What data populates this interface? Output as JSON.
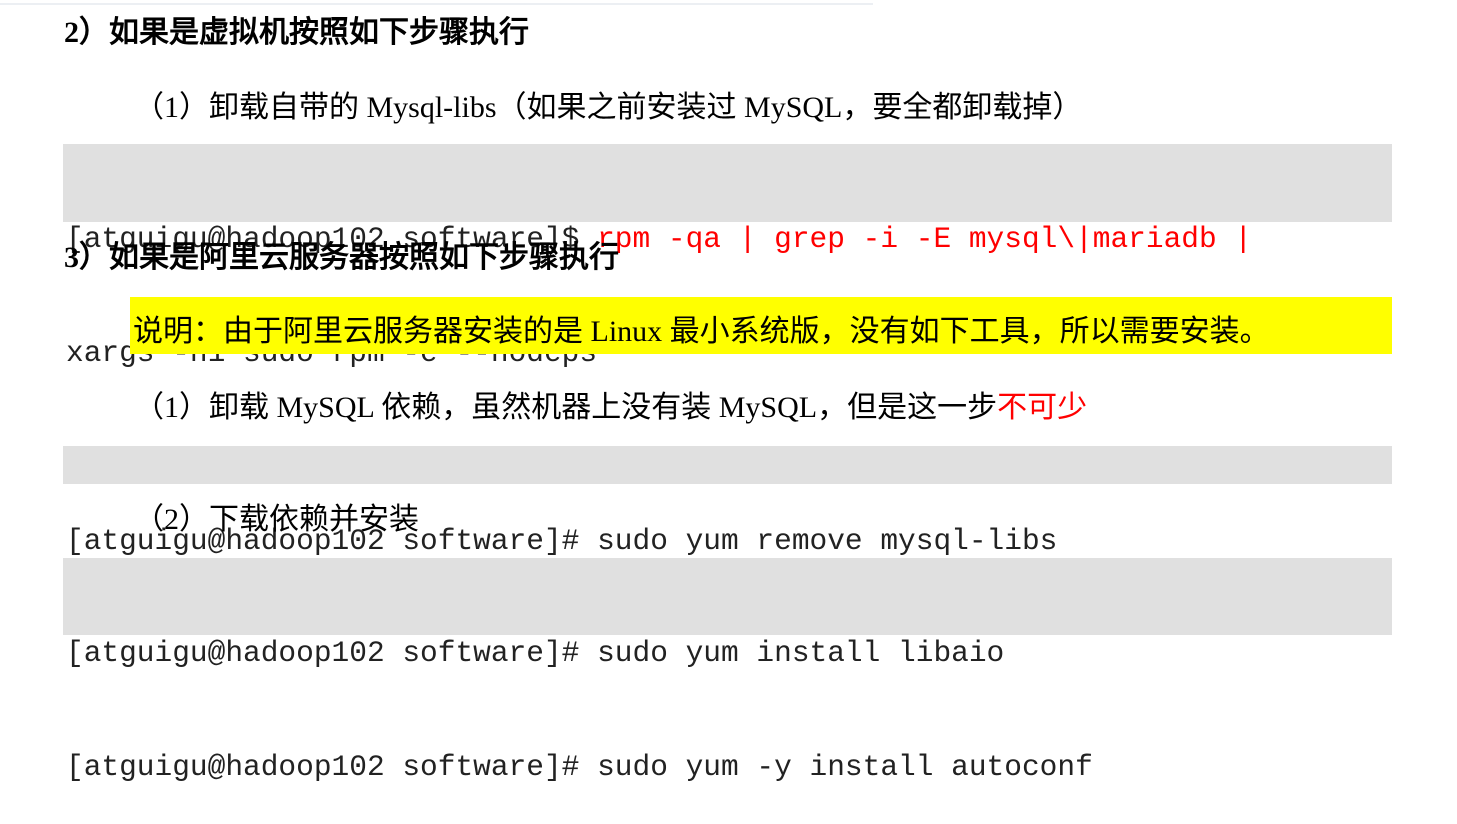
{
  "sections": [
    {
      "heading": "2）如果是虚拟机按照如下步骤执行",
      "step1": {
        "text": "（1）卸载自带的 Mysql-libs（如果之前安装过 MySQL，要全都卸载掉）"
      },
      "code1": {
        "prompt": "[atguigu@hadoop102 software]$ ",
        "command_line1": "rpm -qa | grep -i -E mysql\\|mariadb |",
        "command_line2": "xargs -n1 sudo rpm -e --nodeps"
      }
    },
    {
      "heading": "3）如果是阿里云服务器按照如下步骤执行",
      "note": "说明：由于阿里云服务器安装的是 Linux 最小系统版，没有如下工具，所以需要安装。",
      "step1": {
        "text": "（1）卸载 MySQL 依赖，虽然机器上没有装 MySQL，但是这一步",
        "emphasis": "不可少"
      },
      "code1": {
        "line": "[atguigu@hadoop102 software]# sudo yum remove mysql-libs"
      },
      "step2": {
        "text": "（2）下载依赖并安装"
      },
      "code2": {
        "line1": "[atguigu@hadoop102 software]# sudo yum install libaio",
        "line2": "[atguigu@hadoop102 software]# sudo yum -y install autoconf"
      }
    }
  ],
  "colors": {
    "code_background": "#e0e0e0",
    "highlight": "#ffff00",
    "emphasis_red": "#ff0000"
  }
}
